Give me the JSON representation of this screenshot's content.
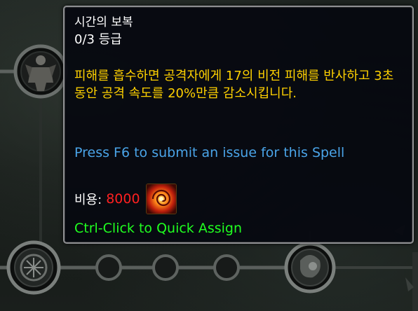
{
  "tooltip": {
    "title": "시간의 보복",
    "rank": "0/3 등급",
    "description": "피해를 흡수하면 공격자에게 17의 비전 피해를 반사하고 3초 동안 공격 속도를 20%만큼 감소시킵니다.",
    "issue_text": "Press F6 to submit an issue for this Spell",
    "cost_label": "비용:",
    "cost_value": "8000",
    "cost_icon": "arcane-vortex-icon",
    "hint": "Ctrl-Click to Quick Assign"
  },
  "colors": {
    "title": "#ffffff",
    "description": "#ffd100",
    "issue": "#4aa4e8",
    "cost_value": "#ff2020",
    "hint": "#20ff20",
    "tooltip_border": "#8f9093"
  },
  "talent_tree": {
    "nodes": [
      {
        "icon": "warrior-figure-icon"
      },
      {
        "icon": "arcane-rune-icon"
      },
      {
        "icon": "empty-node-icon"
      },
      {
        "icon": "empty-node-icon"
      },
      {
        "icon": "empty-node-icon"
      },
      {
        "icon": "dark-spell-icon"
      }
    ]
  }
}
